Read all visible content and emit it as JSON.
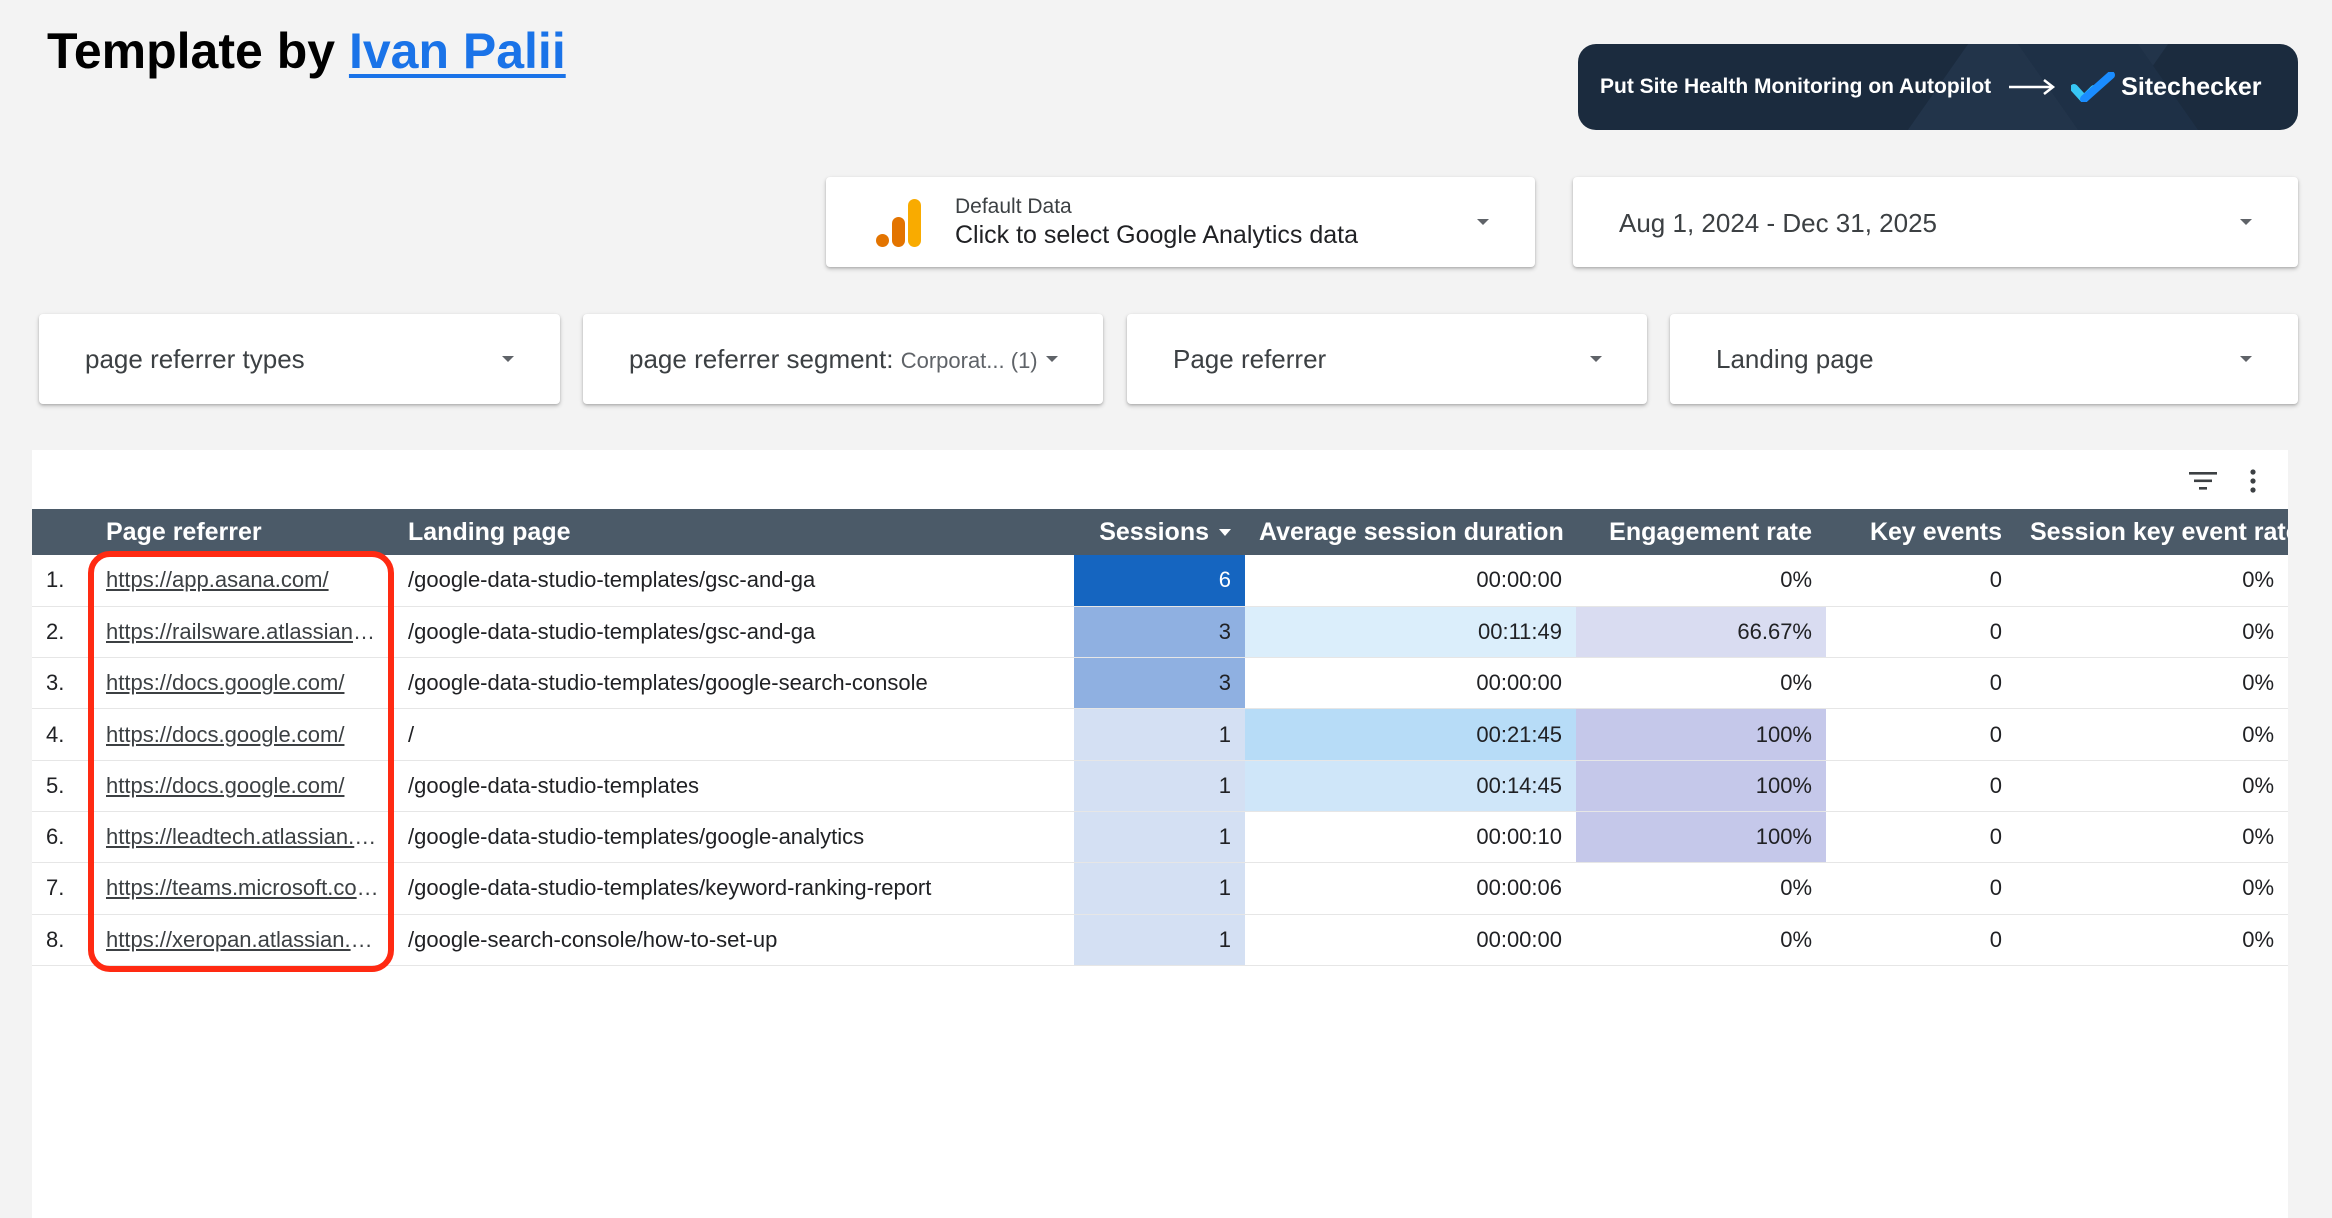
{
  "header": {
    "title_prefix": "Template by ",
    "author_link": "Ivan Palii"
  },
  "banner": {
    "text": "Put Site Health Monitoring on Autopilot",
    "brand": "Sitechecker"
  },
  "data_source": {
    "label": "Default Data",
    "value": "Click to select Google Analytics data"
  },
  "date_range": {
    "value": "Aug 1, 2024 - Dec 31, 2025"
  },
  "filters": [
    {
      "label": "page referrer types",
      "selection": ""
    },
    {
      "label": "page referrer segment",
      "selection": "Corporat... (1)"
    },
    {
      "label": "Page referrer",
      "selection": ""
    },
    {
      "label": "Landing page",
      "selection": ""
    }
  ],
  "table": {
    "columns": [
      "Page referrer",
      "Landing page",
      "Sessions",
      "Average session duration",
      "Engagement rate",
      "Key events",
      "Session key event rate"
    ],
    "rows": [
      {
        "idx": "1.",
        "referrer": "https://app.asana.com/",
        "landing": "/google-data-studio-templates/gsc-and-ga",
        "sessions": "6",
        "duration": "00:00:00",
        "engagement": "0%",
        "key_events": "0",
        "key_rate": "0%"
      },
      {
        "idx": "2.",
        "referrer": "https://railsware.atlassian.net/",
        "landing": "/google-data-studio-templates/gsc-and-ga",
        "sessions": "3",
        "duration": "00:11:49",
        "engagement": "66.67%",
        "key_events": "0",
        "key_rate": "0%"
      },
      {
        "idx": "3.",
        "referrer": "https://docs.google.com/",
        "landing": "/google-data-studio-templates/google-search-console",
        "sessions": "3",
        "duration": "00:00:00",
        "engagement": "0%",
        "key_events": "0",
        "key_rate": "0%"
      },
      {
        "idx": "4.",
        "referrer": "https://docs.google.com/",
        "landing": "/",
        "sessions": "1",
        "duration": "00:21:45",
        "engagement": "100%",
        "key_events": "0",
        "key_rate": "0%"
      },
      {
        "idx": "5.",
        "referrer": "https://docs.google.com/",
        "landing": "/google-data-studio-templates",
        "sessions": "1",
        "duration": "00:14:45",
        "engagement": "100%",
        "key_events": "0",
        "key_rate": "0%"
      },
      {
        "idx": "6.",
        "referrer": "https://leadtech.atlassian.net/",
        "landing": "/google-data-studio-templates/google-analytics",
        "sessions": "1",
        "duration": "00:00:10",
        "engagement": "100%",
        "key_events": "0",
        "key_rate": "0%"
      },
      {
        "idx": "7.",
        "referrer": "https://teams.microsoft.com/",
        "landing": "/google-data-studio-templates/keyword-ranking-report",
        "sessions": "1",
        "duration": "00:00:06",
        "engagement": "0%",
        "key_events": "0",
        "key_rate": "0%"
      },
      {
        "idx": "8.",
        "referrer": "https://xeropan.atlassian.net/",
        "landing": "/google-search-console/how-to-set-up",
        "sessions": "1",
        "duration": "00:00:00",
        "engagement": "0%",
        "key_events": "0",
        "key_rate": "0%"
      }
    ]
  },
  "colors": {
    "header_bg": "#4b5a68",
    "highlight_border": "#ff2a12",
    "link": "#1a73e8",
    "banner_bg": "#1b2b3e"
  },
  "icons": {
    "data_source": "google-analytics-icon",
    "filter": "filter-icon",
    "more": "more-vert-icon",
    "banner_logo": "sitechecker-check-icon",
    "banner_arrow": "arrow-right-icon"
  }
}
